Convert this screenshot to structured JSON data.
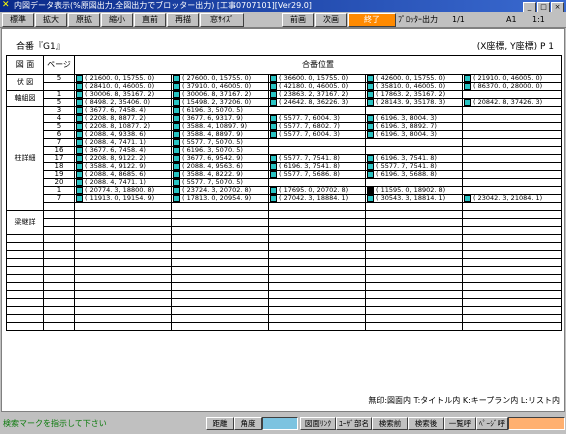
{
  "window": {
    "title": "内図データ表示(%原図出力,全図出力でブロッター出力) [工事0707101][Ver29.0]",
    "controls": [
      "_",
      "□",
      "×"
    ]
  },
  "toolbar": {
    "buttons": [
      "標準",
      "拡大",
      "原拡",
      "縮小",
      "直前",
      "再描",
      "窓ｻｲｽﾞ",
      "前画",
      "次画",
      "終了"
    ],
    "plotter_label": "ﾌﾟﾛｯﾀｰ出力",
    "plotter_value": "1/1",
    "paper": "A1",
    "scale": "1:1"
  },
  "header": {
    "title": "合番『G1』",
    "coords": "(X座標, Y座標) P 1"
  },
  "columns": {
    "drawing": "図 面",
    "page": "ページ",
    "position": "合番位置"
  },
  "groups": [
    {
      "name": "伏 図",
      "rows": 2
    },
    {
      "name": "軸組図",
      "rows": 2
    },
    {
      "name": "柱詳細",
      "rows": 13
    },
    {
      "name": "梁継詳",
      "rows": 3
    }
  ],
  "rows": [
    {
      "page": "5",
      "cells": [
        [
          "c",
          "( 21600. 0, 15755. 0)"
        ],
        [
          "c",
          "( 27600. 0, 15755. 0)"
        ],
        [
          "c",
          "( 36600. 0, 15755. 0)"
        ],
        [
          "c",
          "( 42600. 0, 15755. 0)"
        ],
        [
          "c",
          "( 21910. 0, 46005. 0)"
        ]
      ]
    },
    {
      "page": "",
      "cells": [
        [
          "c",
          "( 28410. 0, 46005. 0)"
        ],
        [
          "c",
          "( 37910. 0, 46005. 0)"
        ],
        [
          "c",
          "( 42180. 0, 46005. 0)"
        ],
        [
          "c",
          "( 35810. 0, 46005. 0)"
        ],
        [
          "c",
          "( 86370. 0, 28000. 0)"
        ]
      ]
    },
    {
      "page": "1",
      "cells": [
        [
          "c",
          "( 30006. 8, 35167. 2)"
        ],
        [
          "c",
          "( 30006. 8, 37167. 2)"
        ],
        [
          "c",
          "( 23863. 2, 37167. 2)"
        ],
        [
          "c",
          "( 17863. 2, 35167. 2)"
        ],
        [
          "",
          ""
        ]
      ]
    },
    {
      "page": "5",
      "cells": [
        [
          "c",
          "( 8498. 2, 35406. 0)"
        ],
        [
          "c",
          "( 15498. 2, 37206. 0)"
        ],
        [
          "c",
          "( 24642. 8, 36226. 3)"
        ],
        [
          "c",
          "( 28143. 9, 35178. 3)"
        ],
        [
          "c",
          "( 20842. 8, 37426. 3)"
        ]
      ]
    },
    {
      "page": "3",
      "cells": [
        [
          "c",
          "( 3677. 6, 7458. 4)"
        ],
        [
          "c",
          "( 6196. 3, 5070. 5)"
        ],
        [
          "",
          ""
        ],
        [
          "",
          ""
        ],
        [
          "",
          ""
        ]
      ]
    },
    {
      "page": "4",
      "cells": [
        [
          "c",
          "( 2208. 8, 8877. 2)"
        ],
        [
          "c",
          "( 3677. 6, 9317. 9)"
        ],
        [
          "c",
          "( 5577. 7, 6004. 3)"
        ],
        [
          "c",
          "( 6196. 3, 8004. 3)"
        ],
        [
          "",
          ""
        ]
      ]
    },
    {
      "page": "5",
      "cells": [
        [
          "c",
          "( 2208. 8, 10877. 2)"
        ],
        [
          "c",
          "( 3588. 4, 10897. 9)"
        ],
        [
          "c",
          "( 5577. 7, 6802. 7)"
        ],
        [
          "c",
          "( 6196. 3, 8892. 7)"
        ],
        [
          "",
          ""
        ]
      ]
    },
    {
      "page": "6",
      "cells": [
        [
          "c",
          "( 2088. 4, 9338. 6)"
        ],
        [
          "c",
          "( 3588. 4, 8897. 9)"
        ],
        [
          "c",
          "( 5577. 7, 6004. 3)"
        ],
        [
          "c",
          "( 6196. 3, 8004. 3)"
        ],
        [
          "",
          ""
        ]
      ]
    },
    {
      "page": "7",
      "cells": [
        [
          "c",
          "( 2088. 4, 7471. 1)"
        ],
        [
          "c",
          "( 5577. 7, 5070. 5)"
        ],
        [
          "",
          ""
        ],
        [
          "",
          ""
        ],
        [
          "",
          ""
        ]
      ]
    },
    {
      "page": "16",
      "cells": [
        [
          "c",
          "( 3677. 6, 7458. 4)"
        ],
        [
          "c",
          "( 6196. 3, 5070. 5)"
        ],
        [
          "",
          ""
        ],
        [
          "",
          ""
        ],
        [
          "",
          ""
        ]
      ]
    },
    {
      "page": "17",
      "cells": [
        [
          "c",
          "( 2208. 8, 9122. 2)"
        ],
        [
          "c",
          "( 3677. 6, 9542. 9)"
        ],
        [
          "c",
          "( 5577. 7, 7541. 8)"
        ],
        [
          "c",
          "( 6196. 3, 7541. 8)"
        ],
        [
          "",
          ""
        ]
      ]
    },
    {
      "page": "18",
      "cells": [
        [
          "c",
          "( 3588. 4, 9122. 9)"
        ],
        [
          "c",
          "( 2088. 4, 9563. 6)"
        ],
        [
          "c",
          "( 6196. 3, 7541. 8)"
        ],
        [
          "c",
          "( 5577. 7, 7541. 8)"
        ],
        [
          "",
          ""
        ]
      ]
    },
    {
      "page": "19",
      "cells": [
        [
          "c",
          "( 2088. 4, 8685. 6)"
        ],
        [
          "c",
          "( 3588. 4, 8222. 9)"
        ],
        [
          "c",
          "( 5577. 7, 5686. 8)"
        ],
        [
          "c",
          "( 6196. 3, 5688. 8)"
        ],
        [
          "",
          ""
        ]
      ]
    },
    {
      "page": "20",
      "cells": [
        [
          "c",
          "( 2088. 4, 7471. 1)"
        ],
        [
          "c",
          "( 5577. 7, 5070. 5)"
        ],
        [
          "",
          ""
        ],
        [
          "",
          ""
        ],
        [
          "",
          ""
        ]
      ]
    },
    {
      "page": "1",
      "cells": [
        [
          "c",
          "( 20774. 3, 18800. 8)"
        ],
        [
          "c",
          "( 23724. 3, 20702. 8)"
        ],
        [
          "c",
          "( 17695. 0, 20702. 8)"
        ],
        [
          "b",
          "( 11595. 0, 18902. 8)"
        ],
        [
          "",
          ""
        ]
      ]
    },
    {
      "page": "7",
      "cells": [
        [
          "c",
          "( 11913. 0, 19154. 9)"
        ],
        [
          "c",
          "( 17813. 0, 20954. 9)"
        ],
        [
          "c",
          "( 27042. 3, 18884. 1)"
        ],
        [
          "c",
          "( 30543. 3, 18814. 1)"
        ],
        [
          "c",
          "( 23042. 3, 21084. 1)"
        ]
      ]
    },
    {
      "page": "",
      "cells": [
        [
          "",
          ""
        ],
        [
          "",
          ""
        ],
        [
          "",
          ""
        ],
        [
          "",
          ""
        ],
        [
          "",
          ""
        ]
      ]
    },
    {
      "page": "",
      "cells": [
        [
          "",
          ""
        ],
        [
          "",
          ""
        ],
        [
          "",
          ""
        ],
        [
          "",
          ""
        ],
        [
          "",
          ""
        ]
      ]
    },
    {
      "page": "",
      "cells": [
        [
          "",
          ""
        ],
        [
          "",
          ""
        ],
        [
          "",
          ""
        ],
        [
          "",
          ""
        ],
        [
          "",
          ""
        ]
      ]
    },
    {
      "page": "",
      "cells": [
        [
          "",
          ""
        ],
        [
          "",
          ""
        ],
        [
          "",
          ""
        ],
        [
          "",
          ""
        ],
        [
          "",
          ""
        ]
      ]
    }
  ],
  "footnote": "無印:図面内 T:タイトル内 K:キープラン内 L:リスト内",
  "status": {
    "message": "検索マークを指示して下さい",
    "buttons": [
      "距離",
      "角度",
      "図面ﾘﾝｸ",
      "ﾕｰｻﾞ部名",
      "検索前",
      "検索後",
      "一覧呼",
      "ﾍﾟｰｼﾞ呼"
    ]
  },
  "colors": {
    "marker": "#29c4c4",
    "active": "#ff8a00",
    "status_text": "#0a7a0a",
    "titlebar": "#0a2a8a"
  }
}
